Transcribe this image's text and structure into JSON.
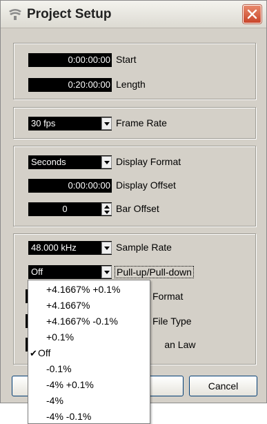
{
  "window": {
    "title": "Project Setup",
    "close_label": "×"
  },
  "timing": {
    "start_value": "0:00:00:00",
    "start_label": "Start",
    "length_value": "0:20:00:00",
    "length_label": "Length"
  },
  "frame": {
    "value": "30 fps",
    "label": "Frame Rate"
  },
  "display": {
    "format_value": "Seconds",
    "format_label": "Display Format",
    "offset_value": "0:00:00:00",
    "offset_label": "Display Offset",
    "bar_offset_value": "0",
    "bar_offset_label": "Bar Offset"
  },
  "audio": {
    "sample_rate_value": "48.000 kHz",
    "sample_rate_label": "Sample Rate",
    "pullup_value": "Off",
    "pullup_label": "Pull-up/Pull-down",
    "format_label_partial": "Format",
    "file_type_label_partial": "File Type",
    "pan_law_label_partial": "Pan Law"
  },
  "footer": {
    "cancel_label": "Cancel"
  },
  "pullup_menu": {
    "options": [
      "+4.1667% +0.1%",
      "+4.1667%",
      "+4.1667% -0.1%",
      "+0.1%",
      "Off",
      "-0.1%",
      "-4% +0.1%",
      "-4%",
      "-4% -0.1%"
    ],
    "selected": "Off",
    "check_glyph": "✔"
  },
  "colors": {
    "dialog_bg": "#d4d0c8",
    "field_bg": "#000000",
    "field_text": "#ffffff",
    "close_red": "#c9452a"
  }
}
